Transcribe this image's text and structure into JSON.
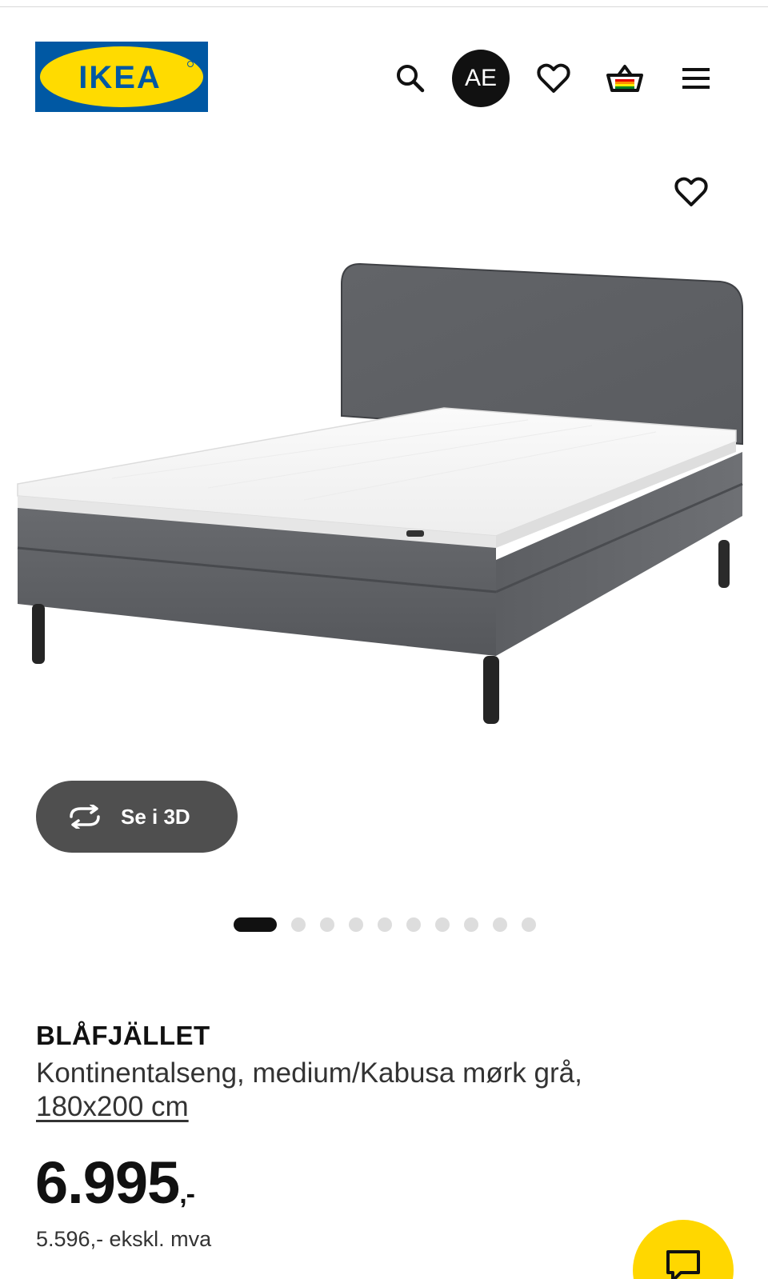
{
  "header": {
    "logo_text": "IKEA",
    "account_initials": "AE"
  },
  "gallery": {
    "view_3d_label": "Se i 3D",
    "image_count": 10,
    "active_index": 0
  },
  "product": {
    "name": "BLÅFJÄLLET",
    "description": "Kontinentalseng, medium/Kabusa mørk grå,",
    "size": "180x200 cm",
    "price": "6.995",
    "price_suffix": ",-",
    "price_ex_vat": "5.596,- ekskl. mva"
  },
  "icons": {
    "search": "search-icon",
    "wishlist": "heart-icon",
    "cart": "basket-icon",
    "menu": "hamburger-menu-icon",
    "rotate": "rotate-3d-icon",
    "chat": "chat-bubble-icon"
  },
  "colors": {
    "ikea_blue": "#0058a3",
    "ikea_yellow": "#ffdb00",
    "button_dark": "#4f4f4f",
    "text_primary": "#111111"
  }
}
